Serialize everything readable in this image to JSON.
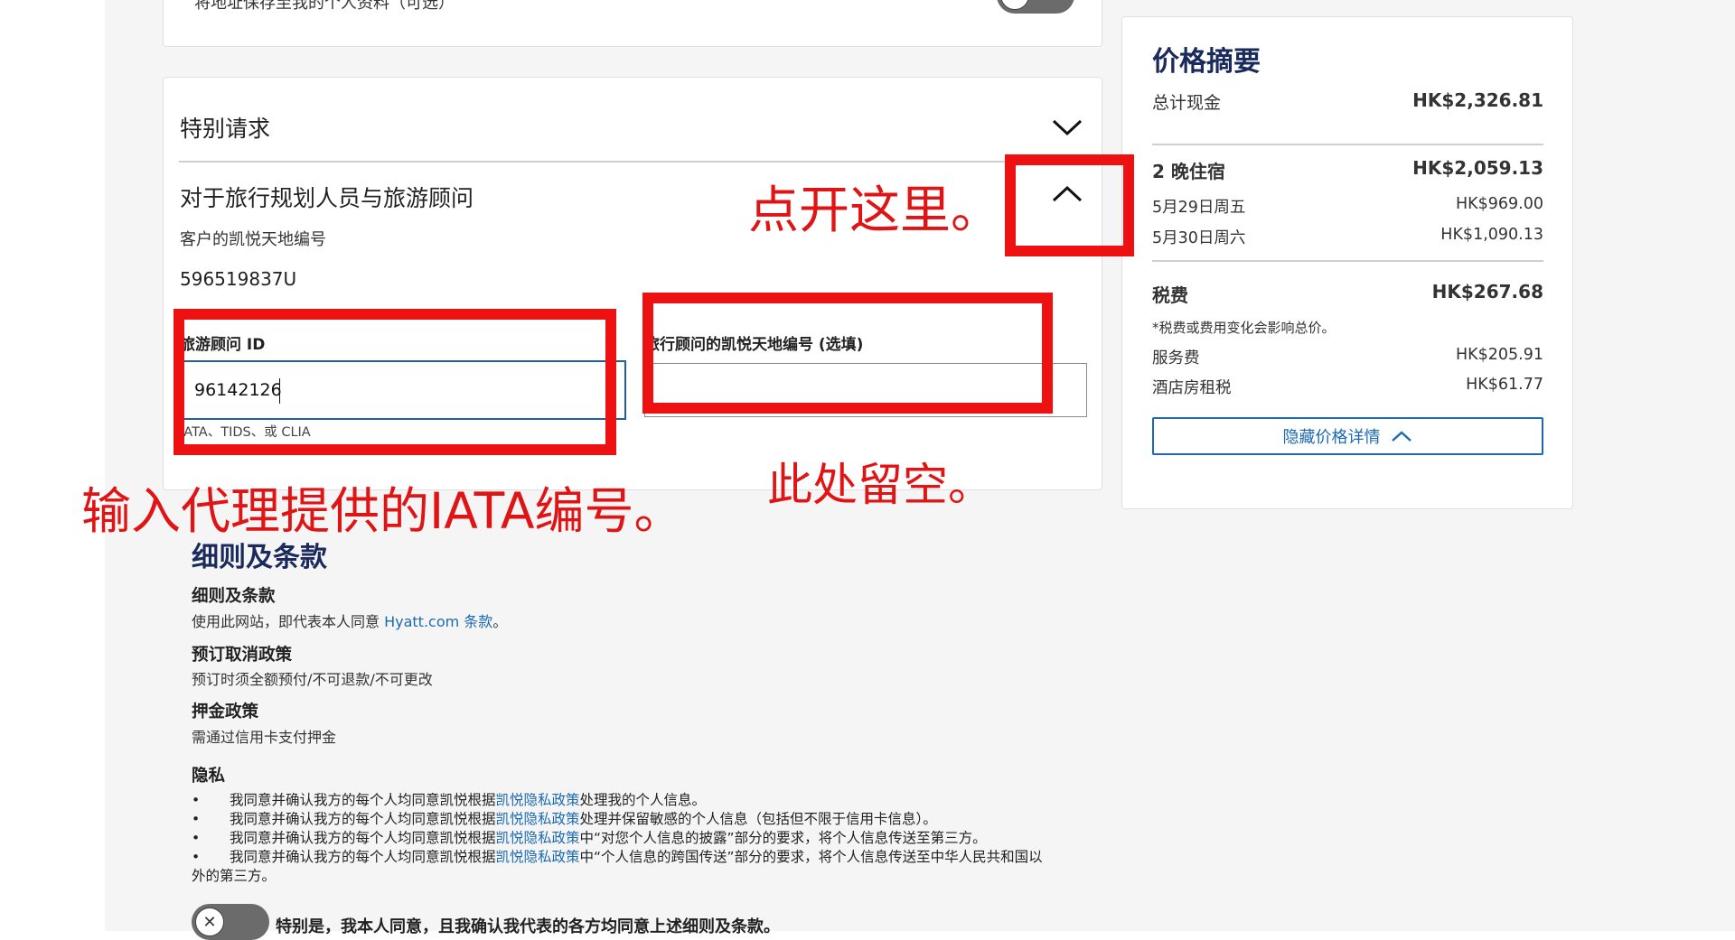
{
  "address_section": {
    "save_address_label": "将地址保存至我的个人资料（可选）"
  },
  "special_requests": {
    "title": "特别请求"
  },
  "travel_planner": {
    "title": "对于旅行规划人员与旅游顾问",
    "customer_id_label": "客户的凯悦天地编号",
    "customer_id_value": "596519837U",
    "agent_id_label": "旅游顾问 ID",
    "agent_id_value": "96142126",
    "agent_id_hint": "IATA、TIDS、或 CLIA",
    "advisor_number_label": "旅行顾问的凯悦天地编号 (选填)",
    "advisor_number_value": ""
  },
  "annotations": {
    "open_here": "点开这里。",
    "enter_iata": "输入代理提供的IATA编号。",
    "leave_blank": "此处留空。",
    "color": "#e01414"
  },
  "price_summary": {
    "title": "价格摘要",
    "total_cash_label": "总计现金",
    "total_cash_value": "HK$2,326.81",
    "nights_label": "2 晚住宿",
    "nights_value": "HK$2,059.13",
    "nights": [
      {
        "date": "5月29日周五",
        "price": "HK$969.00"
      },
      {
        "date": "5月30日周六",
        "price": "HK$1,090.13"
      }
    ],
    "taxes_label": "税费",
    "taxes_value": "HK$267.68",
    "taxes_note": "*税费或费用变化会影响总价。",
    "fees": [
      {
        "name": "服务费",
        "price": "HK$205.91"
      },
      {
        "name": "酒店房租税",
        "price": "HK$61.77"
      }
    ],
    "hide_details_button": "隐藏价格详情"
  },
  "terms": {
    "title": "细则及条款",
    "terms_heading": "细则及条款",
    "terms_text_prefix": "使用此网站，即代表本人同意 ",
    "terms_link": "Hyatt.com 条款",
    "terms_text_suffix": "。",
    "cancel_heading": "预订取消政策",
    "cancel_text": "预订时须全额预付/不可退款/不可更改",
    "deposit_heading": "押金政策",
    "deposit_text": "需通过信用卡支付押金",
    "privacy_heading": "隐私",
    "privacy_items": [
      {
        "prefix": "我同意并确认我方的每个人均同意凯悦根据",
        "link": "凯悦隐私政策",
        "suffix": "处理我的个人信息。"
      },
      {
        "prefix": "我同意并确认我方的每个人均同意凯悦根据",
        "link": "凯悦隐私政策",
        "suffix": "处理并保留敏感的个人信息（包括但不限于信用卡信息）。"
      },
      {
        "prefix": "我同意并确认我方的每个人均同意凯悦根据",
        "link": "凯悦隐私政策",
        "suffix": "中“对您个人信息的披露”部分的要求，将个人信息传送至第三方。"
      },
      {
        "prefix": "我同意并确认我方的每个人均同意凯悦根据",
        "link": "凯悦隐私政策",
        "suffix": "中“个人信息的跨国传送”部分的要求，将个人信息传送至中华人民共和国以"
      }
    ],
    "privacy_wrap": "外的第三方。",
    "consent_label": "特别是，我本人同意，且我确认我代表的各方均同意上述细则及条款。"
  },
  "colors": {
    "link": "#1b6ab1",
    "heading_navy": "#1a2a5c",
    "toggle": "#6b6b6b"
  }
}
